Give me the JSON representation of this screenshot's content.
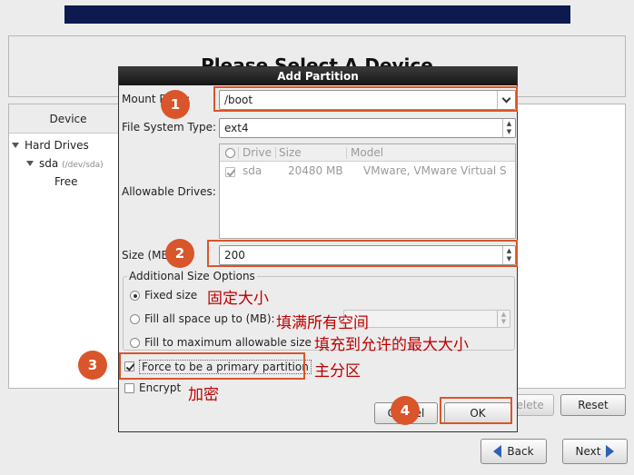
{
  "background": {
    "title": "Please Select A Device",
    "table_header": "Device",
    "tree": [
      {
        "label": "Hard Drives"
      },
      {
        "label": "sda",
        "path": "(/dev/sda)"
      },
      {
        "label": "Free"
      }
    ],
    "buttons": {
      "delete": "Delete",
      "reset": "Reset",
      "back": "Back",
      "next": "Next"
    }
  },
  "dialog": {
    "title": "Add Partition",
    "mount_point_label": "Mount Point:",
    "mount_point_value": "/boot",
    "fs_type_label": "File System Type:",
    "fs_type_value": "ext4",
    "allowable_drives_label": "Allowable Drives:",
    "drives_columns": [
      "",
      "Drive",
      "Size",
      "Model"
    ],
    "drives": [
      {
        "drive": "sda",
        "size": "20480 MB",
        "model": "VMware, VMware Virtual S"
      }
    ],
    "size_label": "Size (MB):",
    "size_value": "200",
    "additional_size_options": "Additional Size Options",
    "options": {
      "fixed": "Fixed size",
      "fill_up_to": "Fill all space up to (MB):",
      "fill_max": "Fill to maximum allowable size"
    },
    "force_primary": "Force to be a primary partition",
    "encrypt": "Encrypt",
    "cancel": "Cancel",
    "ok": "OK"
  },
  "annotations": {
    "badges": [
      "1",
      "2",
      "3",
      "4"
    ],
    "notes": {
      "fixed": "固定大小",
      "fill_up_to": "填满所有空间",
      "fill_max": "填充到允许的最大大小",
      "primary": "主分区",
      "encrypt": "加密"
    },
    "color": "#d9552b"
  }
}
